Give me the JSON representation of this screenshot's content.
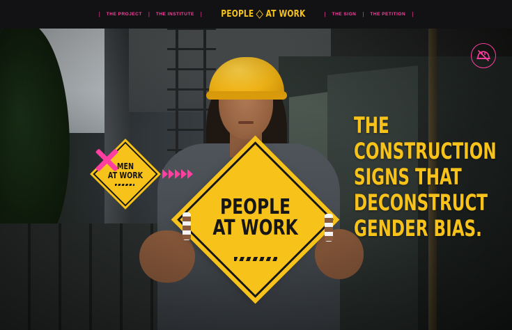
{
  "nav": {
    "items_left": [
      "THE PROJECT",
      "THE INSTITUTE"
    ],
    "logo_left": "PEOPLE",
    "logo_right": "AT WORK",
    "items_right": [
      "THE SIGN",
      "THE PETITION"
    ],
    "separator": "|"
  },
  "hero": {
    "big_sign_line1": "PEOPLE",
    "big_sign_line2": "AT WORK",
    "small_sign_line1": "MEN",
    "small_sign_line2": "AT WORK",
    "headline": [
      "THE",
      "CONSTRUCTION",
      "SIGNS THAT",
      "DECONSTRUCT",
      "GENDER BIAS."
    ],
    "icon": "hard-hat-icon"
  },
  "colors": {
    "accent_pink": "#ff3fa0",
    "sign_yellow": "#f7c21a",
    "nav_bg": "#121214"
  }
}
